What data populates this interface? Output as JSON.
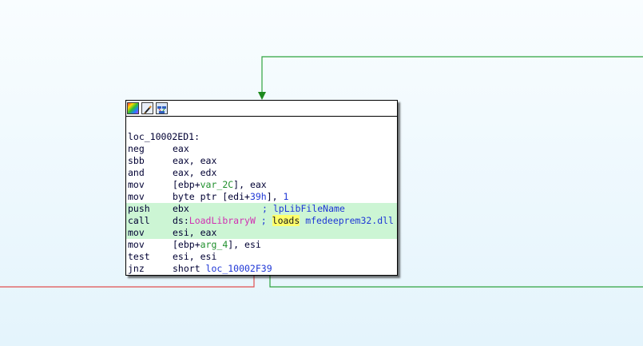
{
  "app": {
    "name": "IDA graph view"
  },
  "toolbar": {
    "icons": [
      "color-palette-icon",
      "edit-pencil-icon",
      "graph-view-icon"
    ]
  },
  "block": {
    "label": "loc_10002ED1:",
    "lines": [
      {
        "mnemonic": "neg",
        "ops": "eax"
      },
      {
        "mnemonic": "sbb",
        "ops": "eax, eax"
      },
      {
        "mnemonic": "and",
        "ops": "eax, edx"
      },
      {
        "mnemonic": "mov",
        "ops_prefix": "[ebp+",
        "ops_var": "var_2C",
        "ops_suffix": "], eax"
      },
      {
        "mnemonic": "mov",
        "ops_prefix": "byte ptr [edi+",
        "ops_num": "39h",
        "ops_suffix": "], ",
        "ops_num2": "1"
      },
      {
        "mnemonic": "push",
        "ops": "ebx",
        "comment_sep": "; ",
        "comment": "lpLibFileName"
      },
      {
        "mnemonic": "call",
        "ops_prefix": "ds:",
        "ops_imp": "LoadLibraryW",
        "comment_sep": " ; ",
        "comment_kw": "loads",
        "comment": " mfedeeprem32.dll"
      },
      {
        "mnemonic": "mov",
        "ops": "esi, eax"
      },
      {
        "mnemonic": "mov",
        "ops_prefix": "[ebp+",
        "ops_var": "arg_4",
        "ops_suffix": "], esi"
      },
      {
        "mnemonic": "test",
        "ops": "esi, esi"
      },
      {
        "mnemonic": "jnz",
        "ops_prefix": "short ",
        "ops_ref": "loc_10002F39"
      }
    ]
  },
  "colors": {
    "edge_true": "#2fa43f",
    "edge_false": "#e05050",
    "edge_incoming": "#2fa43f",
    "highlight": "#ccf5d4"
  }
}
